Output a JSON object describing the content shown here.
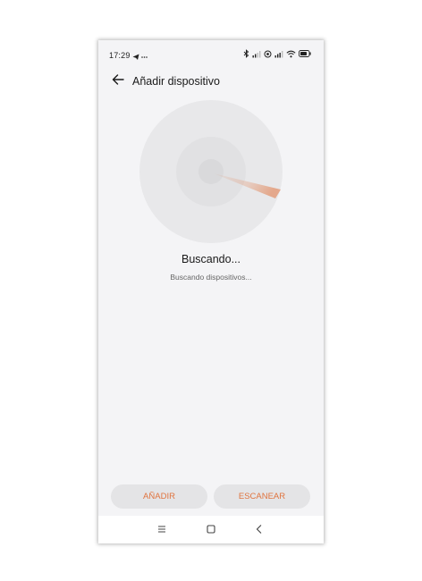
{
  "status_bar": {
    "time": "17:29",
    "left_icons": [
      "telegram-icon",
      "more-dots-icon"
    ],
    "right_icons": [
      "bluetooth-icon",
      "signal-icon",
      "alarm-icon",
      "signal-icon",
      "wifi-icon",
      "battery-icon"
    ]
  },
  "header": {
    "title": "Añadir dispositivo",
    "back_icon": "back-arrow-icon"
  },
  "scan": {
    "title": "Buscando...",
    "subtitle": "Buscando dispositivos..."
  },
  "buttons": {
    "add_label": "AÑADIR",
    "scan_label": "ESCANEAR"
  },
  "nav": {
    "items": [
      "menu-icon",
      "home-icon",
      "back-icon"
    ]
  },
  "colors": {
    "accent": "#e0743f",
    "background": "#f4f4f6",
    "button_bg": "#e4e4e6"
  }
}
